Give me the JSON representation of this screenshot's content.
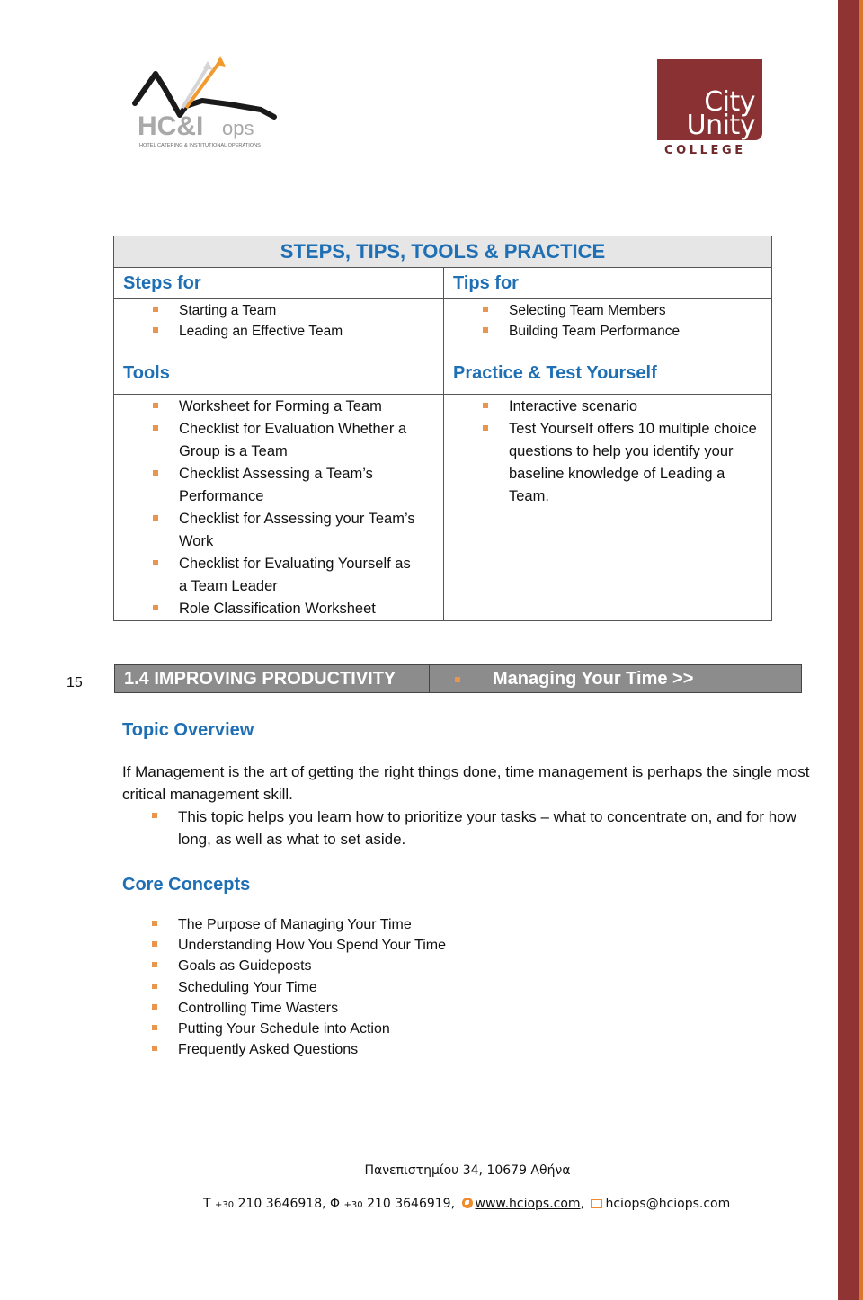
{
  "logos": {
    "left": {
      "name": "HC&I ops",
      "mark": "HC&I",
      "suffix": "ops",
      "tagline": "HOTEL CATERING & INSTITUTIONAL OPERATIONS"
    },
    "right": {
      "line1": "City",
      "line2": "Unity",
      "line3": "COLLEGE"
    }
  },
  "colors": {
    "heading_blue": "#1f6fb5",
    "bullet_orange": "#e8954d",
    "brand_maroon": "#8f3433",
    "banner_gray": "#8c8c8c"
  },
  "table": {
    "title": "STEPS, TIPS, TOOLS & PRACTICE",
    "steps": {
      "heading": "Steps for",
      "items": [
        "Starting a Team",
        "Leading an Effective Team"
      ]
    },
    "tips": {
      "heading": "Tips for",
      "items": [
        "Selecting Team Members",
        "Building Team Performance"
      ]
    },
    "tools": {
      "heading": "Tools",
      "items": [
        "Worksheet for Forming a Team",
        "Checklist for Evaluation Whether a Group is a Team",
        "Checklist Assessing a Team’s Performance",
        "Checklist for Assessing your Team’s Work",
        "Checklist for Evaluating Yourself as a Team Leader",
        "Role Classification Worksheet"
      ]
    },
    "practice": {
      "heading": "Practice & Test Yourself",
      "items": [
        "Interactive scenario",
        "Test Yourself offers 10 multiple choice questions to help you identify your baseline knowledge of Leading a Team."
      ]
    }
  },
  "page_number": "15",
  "banner": {
    "section": "1.4 IMPROVING PRODUCTIVITY",
    "link": "Managing Your Time >>"
  },
  "overview": {
    "heading": "Topic Overview",
    "paragraph": "If Management is the art of getting the right things done, time management is perhaps the single most critical management skill.",
    "bullet": "This topic helps you learn how to prioritize your tasks – what to concentrate on, and for how long, as well as what to set aside."
  },
  "core": {
    "heading": "Core Concepts",
    "items": [
      "The Purpose of Managing Your Time",
      "Understanding How You Spend Your Time",
      "Goals as Guideposts",
      "Scheduling Your Time",
      "Controlling Time Wasters",
      "Putting Your Schedule into Action",
      "Frequently Asked Questions"
    ]
  },
  "footer": {
    "address": "Πανεπιστημίου 34, 10679 Αθήνα",
    "tel_label": "Τ",
    "tel_cc": "+30",
    "tel": "210 3646918,",
    "fax_label": "Φ",
    "fax_cc": "+30",
    "fax": "210 3646919,",
    "website": "www.hciops.com",
    "email": "hciops@hciops.com"
  }
}
